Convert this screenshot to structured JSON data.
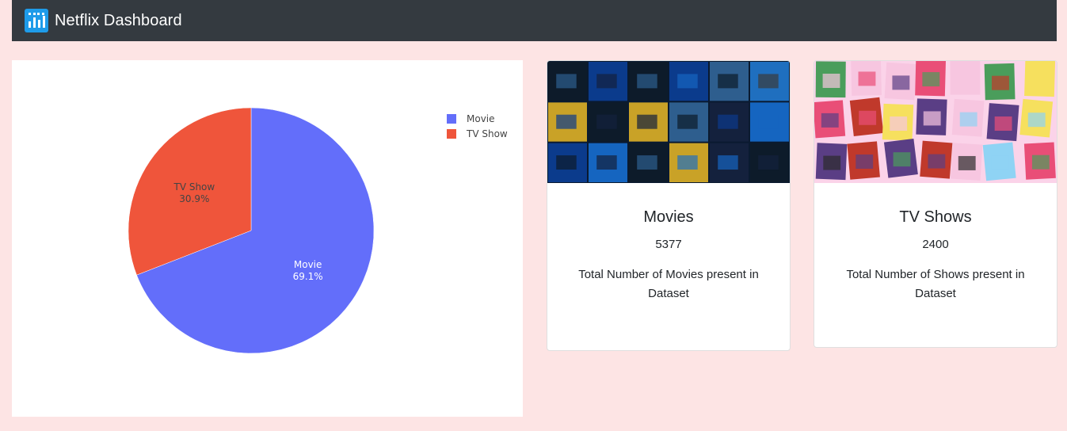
{
  "navbar": {
    "title": "Netflix Dashboard",
    "icon": "bar-chart-icon"
  },
  "chart_data": {
    "type": "pie",
    "categories": [
      "Movie",
      "TV Show"
    ],
    "values": [
      69.1,
      30.9
    ],
    "labels": [
      "Movie\n69.1%",
      "TV Show\n30.9%"
    ],
    "colors": [
      "#636efa",
      "#ef553b"
    ],
    "legend_placement": "top-right",
    "title": ""
  },
  "cards": {
    "movies": {
      "title": "Movies",
      "count": "5377",
      "description": "Total Number of Movies present in Dataset",
      "image": "movie-posters-collage"
    },
    "shows": {
      "title": "TV Shows",
      "count": "2400",
      "description": "Total Number of Shows present in Dataset",
      "image": "tv-show-posters-collage"
    }
  },
  "colors": {
    "page_bg": "#fde4e4",
    "navbar_bg": "#343a40",
    "brand_icon": "#1e9be9"
  }
}
